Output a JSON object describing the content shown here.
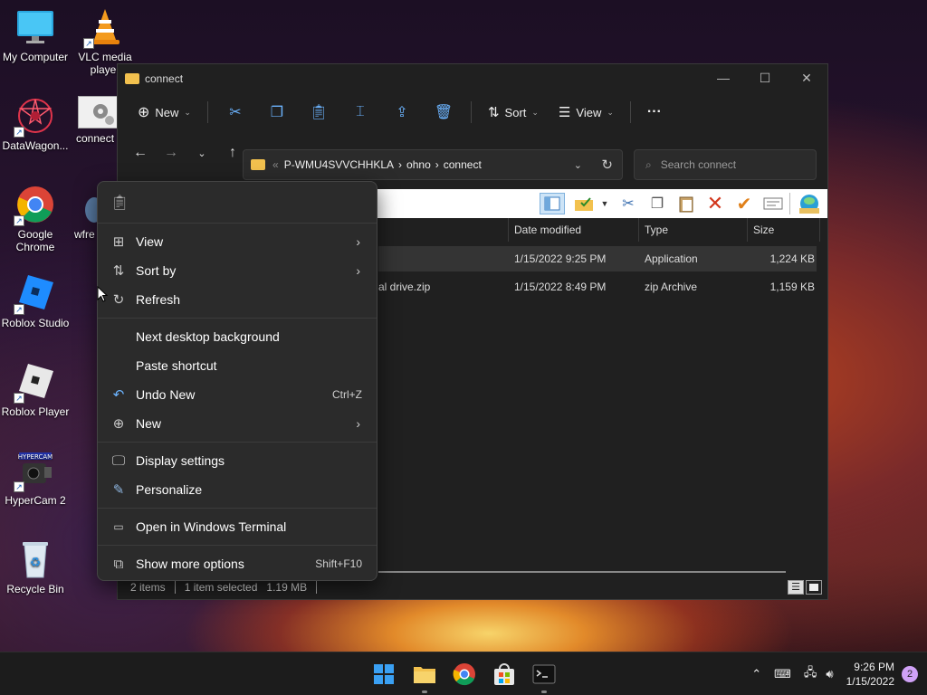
{
  "desktop": {
    "icons": [
      {
        "label": "My Computer"
      },
      {
        "label": "VLC media player"
      },
      {
        "label": "DataWagon..."
      },
      {
        "label": "connect"
      },
      {
        "label": "Google Chrome"
      },
      {
        "label": "wfre"
      },
      {
        "label": "Roblox Studio"
      },
      {
        "label": "Roblox Player"
      },
      {
        "label": "HyperCam 2"
      },
      {
        "label": "Recycle Bin"
      }
    ]
  },
  "explorer": {
    "title": "connect",
    "toolbar": {
      "new_label": "New",
      "sort_label": "Sort",
      "view_label": "View",
      "more_label": "···"
    },
    "address": {
      "crumbs": [
        "P-WMU4SVVCHHKLA",
        "ohno",
        "connect"
      ],
      "overflow": "«"
    },
    "search": {
      "placeholder": "Search connect"
    },
    "columns": {
      "date": "Date modified",
      "type": "Type",
      "size": "Size"
    },
    "files": [
      {
        "name": "",
        "date": "1/15/2022 9:25 PM",
        "type": "Application",
        "size": "1,224 KB"
      },
      {
        "name": "al drive.zip",
        "date": "1/15/2022 8:49 PM",
        "type": "zip Archive",
        "size": "1,159 KB"
      }
    ],
    "status": {
      "items": "2 items",
      "selected": "1 item selected",
      "size": "1.19 MB"
    }
  },
  "context_menu": {
    "items": [
      {
        "label": "View"
      },
      {
        "label": "Sort by"
      },
      {
        "label": "Refresh"
      },
      {
        "label": "Next desktop background"
      },
      {
        "label": "Paste shortcut"
      },
      {
        "label": "Undo New",
        "shortcut": "Ctrl+Z"
      },
      {
        "label": "New"
      },
      {
        "label": "Display settings"
      },
      {
        "label": "Personalize"
      },
      {
        "label": "Open in Windows Terminal"
      },
      {
        "label": "Show more options",
        "shortcut": "Shift+F10"
      }
    ]
  },
  "taskbar": {
    "time": "9:26 PM",
    "date": "1/15/2022",
    "notifications": "2"
  }
}
